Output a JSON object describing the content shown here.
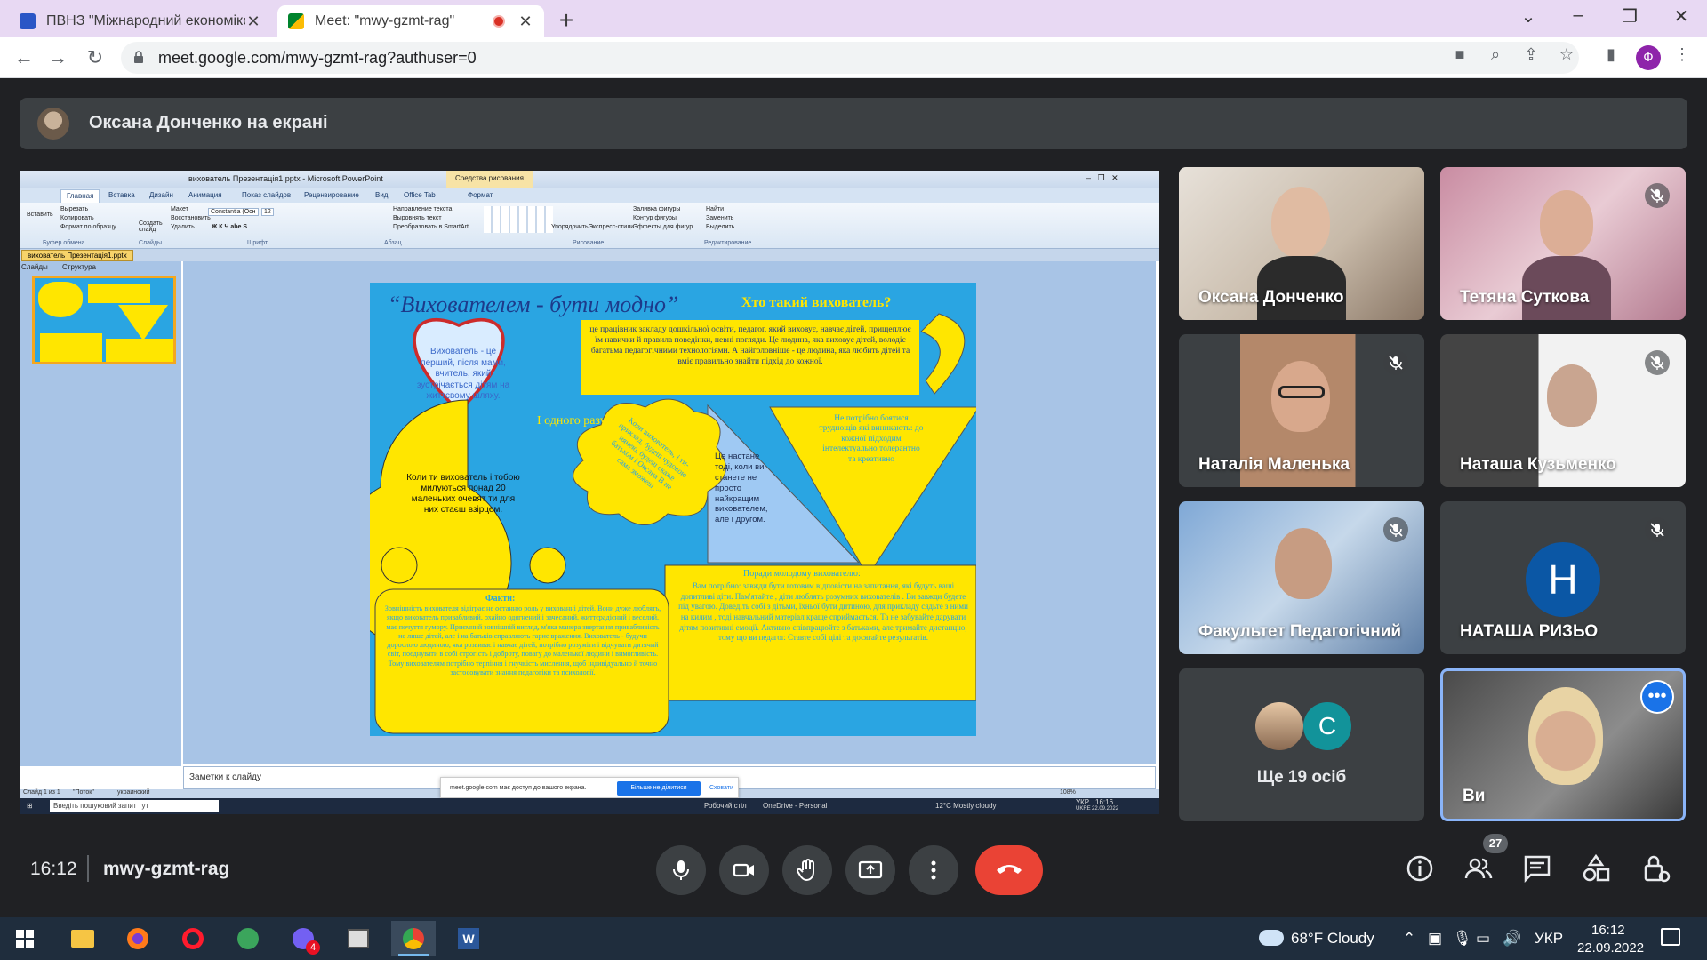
{
  "browser": {
    "tabs": [
      {
        "title": "ПВНЗ \"Міжнародний економіко",
        "active": false
      },
      {
        "title": "Meet: \"mwy-gzmt-rag\"",
        "active": true
      }
    ],
    "url": "meet.google.com/mwy-gzmt-rag?authuser=0",
    "profile_initial": "Ф"
  },
  "meet": {
    "presenting_text": "Оксана Донченко на екрані",
    "time": "16:12",
    "meeting_code": "mwy-gzmt-rag",
    "participants_count": "27",
    "participants": [
      {
        "name": "Оксана Донченко",
        "muted": false
      },
      {
        "name": "Тетяна Суткова",
        "muted": true
      },
      {
        "name": "Наталія Маленька",
        "muted": true
      },
      {
        "name": "Наташа Кузьменко",
        "muted": true
      },
      {
        "name": "Факультет Педагогічний",
        "muted": true
      },
      {
        "name": "НАТАША РИЗЬО",
        "muted": true,
        "avatar_letter": "Н"
      },
      {
        "name": "Ще 19 осіб",
        "avatar_letter": "С"
      },
      {
        "name": "Ви",
        "muted": false
      }
    ],
    "colors": {
      "end_call": "#ea4335",
      "bg": "#202124",
      "tile": "#3c4043",
      "accent": "#1a73e8"
    }
  },
  "shared_screen": {
    "window_title": "вихователь Презентація1.pptx - Microsoft PowerPoint",
    "context_tab": "Средства рисования",
    "ribbon_tabs": [
      "Главная",
      "Вставка",
      "Дизайн",
      "Анимация",
      "Показ слайдов",
      "Рецензирование",
      "Вид",
      "Office Tab",
      "Формат"
    ],
    "ribbon_groups": [
      "Буфер обмена",
      "Слайды",
      "Шрифт",
      "Абзац",
      "Рисование",
      "Редактирование"
    ],
    "ribbon_items": {
      "paste": "Вставить",
      "cut": "Вырезать",
      "copy": "Копировать",
      "format_painter": "Формат по образцу",
      "new_slide": "Создать слайд",
      "layout": "Макет",
      "reset": "Восстановить",
      "delete": "Удалить",
      "font": "Constantia (Осн",
      "size": "12",
      "text_direction": "Направление текста",
      "align_text": "Выровнять текст",
      "smartart": "Преобразовать в SmartArt",
      "arrange": "Упорядочить",
      "quick_styles": "Экспресс-стили",
      "fill": "Заливка фигуры",
      "outline": "Контур фигуры",
      "effects": "Эффекты для фигур",
      "find": "Найти",
      "replace": "Заменить",
      "select": "Выделить"
    },
    "doc_tab": "вихователь Презентація1.pptx",
    "left_tabs": [
      "Слайды",
      "Структура"
    ],
    "notes_placeholder": "Заметки к слайду",
    "status": {
      "slide": "Слайд 1 из 1",
      "theme": "\"Поток\"",
      "lang": "украинский",
      "zoom": "108%"
    },
    "share_notice": "meet.google.com має доступ до вашого екрана.",
    "stop_sharing": "Більше не ділитися",
    "hide": "Сховати",
    "inner_taskbar": {
      "search": "Введіть пошуковий запит тут",
      "desktop": "Робочий стіл",
      "onedrive": "OneDrive - Personal",
      "weather": "12°C  Mostly cloudy",
      "lang": "УКР",
      "lang2": "UKRE",
      "time": "16:16",
      "date": "22.09.2022"
    }
  },
  "slide": {
    "title": "“Вихователем -  бути модно”",
    "question": "Хто такий вихователь?",
    "definition": "це працівник закладу дошкільної освіти, педагог, який виховує, навчає дітей, прищеплює їм навички й правила поведінки, певні погляди. Це людина, яка виховує дітей, володіє багатьма педагогічними технологіями. А найголовніше - це людина, яка любить дітей та вміє правильно знайти підхід до кожної.",
    "heart": "Вихователь - це перший, після мами, вчитель, який зустрічається дітям на життєвому шляху.",
    "at_once": "І одного разу:",
    "pie": "Коли ти вихователь і тобою милуються понад 20 маленьких очевят ти для них стаєш взірцем.",
    "cloud": "Коли вихователь, і ти-приклад, будеш чудовою нянею, будеш скаже батьком і Оксана В не сама зможеш",
    "triangle_left": "Це настане тоді, коли ви станете не просто найкращим вихователем, але і другом.",
    "triangle_right": "Не потрібно боятися труднощів які виникають: до кожної підходим інтелектуально толерантно та креативно",
    "facts_title": "Факти:",
    "facts": "Зовнішність вихователя відіграє не останню роль у вихованні дітей. Вони дуже люблять, якщо вихователь привабливий, охайно одягнений і зачесаний, життєрадісний і веселий, має почуття гумору. Приємний зовнішній вигляд, м'яка манера звертання привабливість не лише дітей, але і на батьків справляють гарне враження. Вихователь - будучи дорослою людиною, яка розвиває і навчає дітей, потрібно розуміти і відчувати дитячий світ, поєднувати в собі строгість і доброту, повагу до маленької людини і вимогливість. Тому вихователям потрібно терпіння і гнучкість мислення, щоб індивідуально й точно застосовувати знання педагогіки та психології.",
    "advice_title": "Поради молодому вихователю:",
    "advice": "Вам потрібно: завжди бути готовим відповісти на запитання, які будуть ваші допитливі діти. Пам'ятайте , діти люблять розумних вихователів . Ви завжди будете під увагою. Доведіть собі з дітьми, їхньої бути дитиною, для прикладу сядьте з ними на килим , тоді навчальний матеріал краще сприймається. Та не забувайте дарувати дітям позитивні емоції. Активно співпрацюйте з батьками, але тримайте дистанцію, тому що ви педагог. Ставте собі цілі та досягайте результатів."
  },
  "taskbar": {
    "weather": "68°F  Cloudy",
    "lang": "УКР",
    "time": "16:12",
    "date": "22.09.2022",
    "viber_badge": "4"
  }
}
